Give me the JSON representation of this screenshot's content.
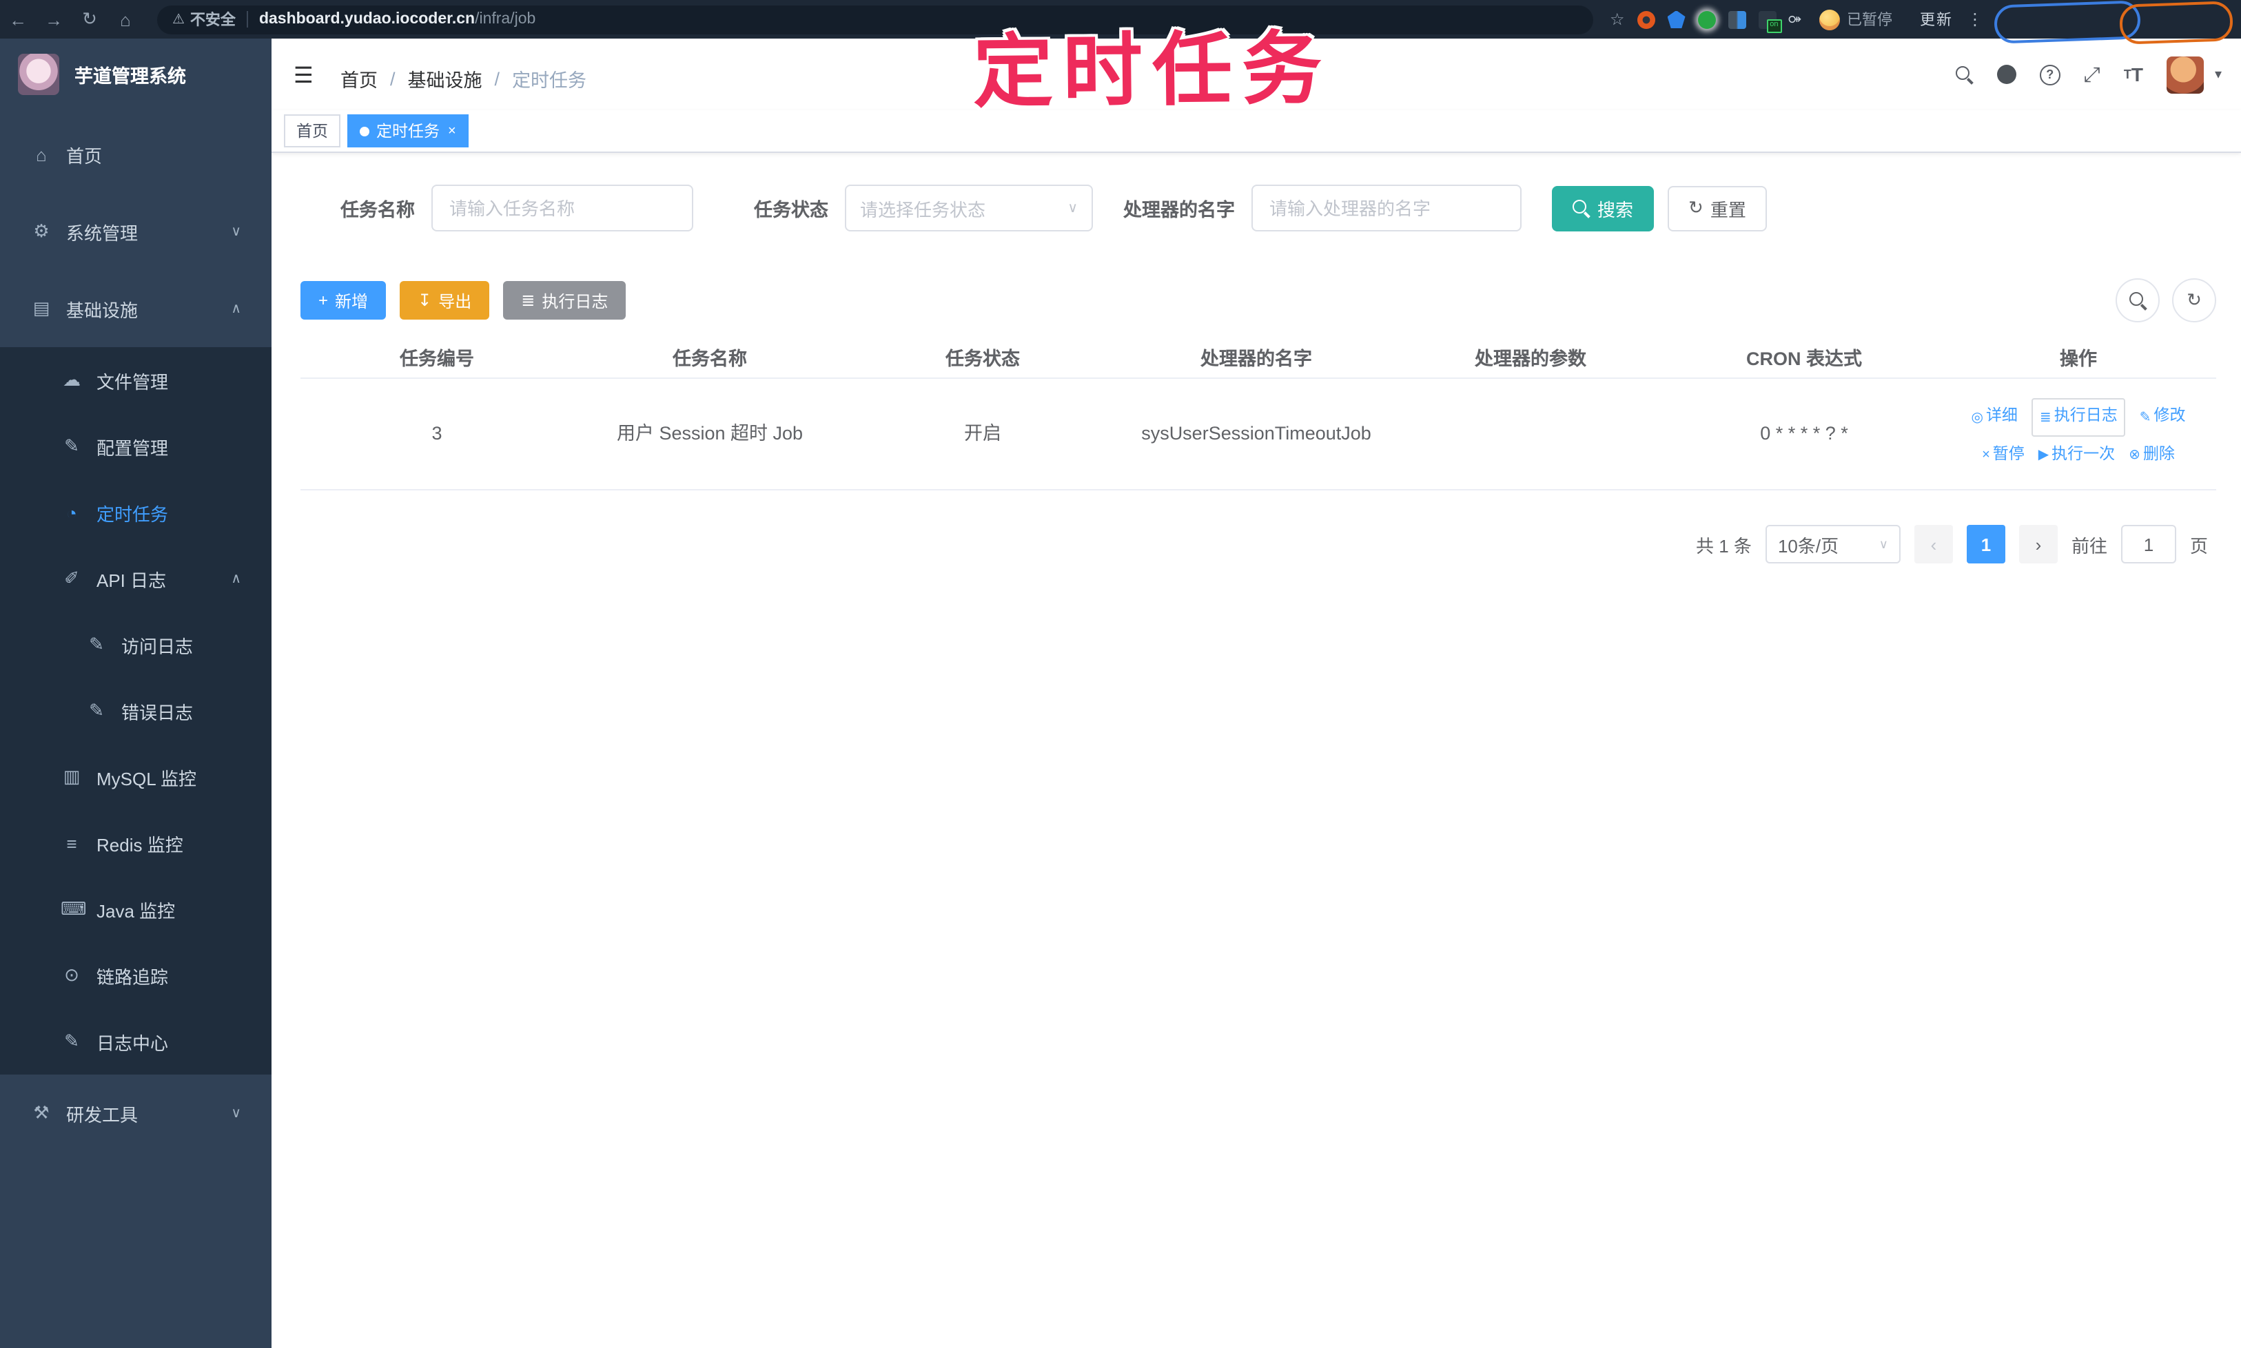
{
  "browser": {
    "security_label": "不安全",
    "url_host": "dashboard.yudao.iocoder.cn",
    "url_path": "/infra/job",
    "paused_badge": "已暂停",
    "update_button": "更新",
    "extension_on_badge": "on"
  },
  "annotation": {
    "text": "定时任务"
  },
  "icons": {
    "back": "←",
    "forward": "→",
    "reload": "↻",
    "home": "⌂",
    "warning": "⚠",
    "star": "☆",
    "kebab": "⋮",
    "puzzle": "⚩",
    "hamburger": "☰",
    "breadcrumb_sep": "/",
    "caret": "▾",
    "fullscreen": "⤢",
    "textsize_big": "T",
    "textsize_small": "T",
    "chevron_down": "∨",
    "chevron_up": "∧",
    "menu_home": "⌂",
    "menu_system": "⚙",
    "menu_infra": "▤",
    "menu_file": "☁",
    "menu_config": "✎",
    "menu_job": "◔",
    "menu_api": "✐",
    "menu_access": "✎",
    "menu_error": "✎",
    "menu_mysql": "▥",
    "menu_redis": "≡",
    "menu_java": "⌨",
    "menu_trace": "⊙",
    "menu_logcenter": "✎",
    "menu_devtools": "⚒",
    "plus": "+",
    "download": "↧",
    "lines": "≣",
    "refresh": "↻",
    "detail": "◎",
    "edit": "✎",
    "pause": "×",
    "play": "▶",
    "trash": "⊗",
    "close": "×"
  },
  "sidebar": {
    "title": "芋道管理系统",
    "items": [
      {
        "label": "首页"
      },
      {
        "label": "系统管理"
      },
      {
        "label": "基础设施"
      },
      {
        "label": "文件管理"
      },
      {
        "label": "配置管理"
      },
      {
        "label": "定时任务"
      },
      {
        "label": "API 日志"
      },
      {
        "label": "访问日志"
      },
      {
        "label": "错误日志"
      },
      {
        "label": "MySQL 监控"
      },
      {
        "label": "Redis 监控"
      },
      {
        "label": "Java 监控"
      },
      {
        "label": "链路追踪"
      },
      {
        "label": "日志中心"
      },
      {
        "label": "研发工具"
      }
    ]
  },
  "navbar": {
    "breadcrumb": [
      "首页",
      "基础设施",
      "定时任务"
    ]
  },
  "tags": [
    {
      "label": "首页"
    },
    {
      "label": "定时任务"
    }
  ],
  "filters": {
    "name_label": "任务名称",
    "name_placeholder": "请输入任务名称",
    "status_label": "任务状态",
    "status_placeholder": "请选择任务状态",
    "handler_label": "处理器的名字",
    "handler_placeholder": "请输入处理器的名字",
    "search_label": "搜索",
    "reset_label": "重置"
  },
  "toolbar": {
    "add_label": "新增",
    "export_label": "导出",
    "exec_log_label": "执行日志"
  },
  "table": {
    "columns": [
      "任务编号",
      "任务名称",
      "任务状态",
      "处理器的名字",
      "处理器的参数",
      "CRON 表达式",
      "操作"
    ],
    "row": {
      "id": "3",
      "name": "用户 Session 超时 Job",
      "status": "开启",
      "handler": "sysUserSessionTimeoutJob",
      "param": "",
      "cron": "0 * * * * ? *"
    }
  },
  "actions": {
    "detail": "详细",
    "exec_log": "执行日志",
    "modify": "修改",
    "pause": "暂停",
    "run_once": "执行一次",
    "delete": "删除"
  },
  "pagination": {
    "total": "共 1 条",
    "page_size": "10条/页",
    "prev": "‹",
    "next": "›",
    "current": "1",
    "goto_label": "前往",
    "goto_value": "1",
    "page_suffix": "页"
  }
}
